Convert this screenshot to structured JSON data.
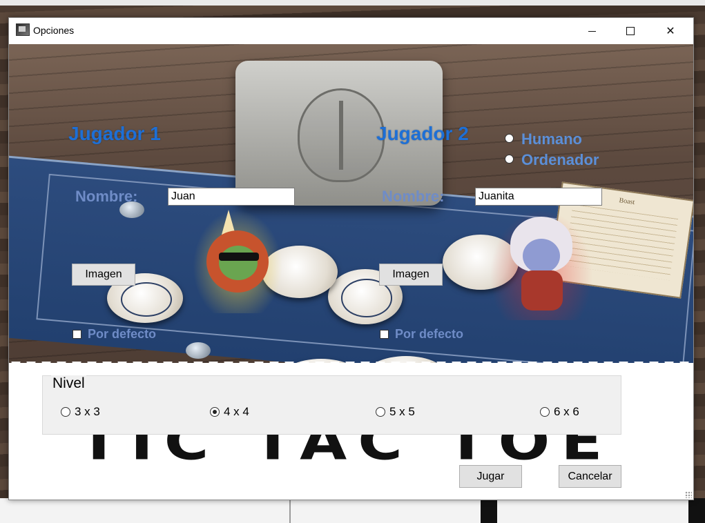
{
  "window": {
    "title": "Opciones",
    "minimize_label": "─",
    "maximize_label": "☐",
    "close_label": "✕"
  },
  "player1": {
    "title": "Jugador 1",
    "name_label": "Nombre:",
    "name_value": "Juan",
    "image_button": "Imagen",
    "default_label": "Por defecto",
    "default_checked": false
  },
  "player2": {
    "title": "Jugador 2",
    "name_label": "Nombre:",
    "name_value": "Juanita",
    "image_button": "Imagen",
    "default_label": "Por defecto",
    "default_checked": false,
    "modes": [
      "Humano",
      "Ordenador"
    ]
  },
  "decor": {
    "card_title": "Boast"
  },
  "level": {
    "legend": "Nivel",
    "options": [
      "3 x 3",
      "4 x 4",
      "5 x 5",
      "6 x 6"
    ],
    "selected": "4 x 4"
  },
  "background_text": "TIC TAC TOE",
  "actions": {
    "play": "Jugar",
    "cancel": "Cancelar"
  },
  "colors": {
    "player_title": "#1d6fd6",
    "label": "#6f8cc7"
  }
}
